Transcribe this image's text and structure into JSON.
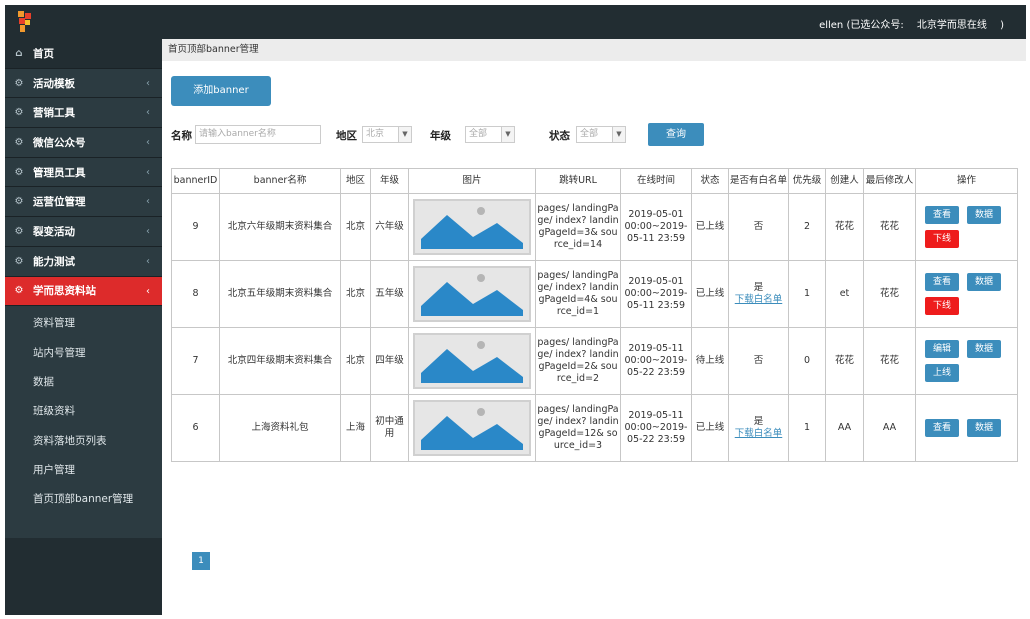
{
  "topbar": {
    "user_text": "ellen  (已选公众号:",
    "account": "北京学而思在线",
    "close_paren": ")"
  },
  "sidebar": {
    "home": "首页",
    "items": [
      {
        "label": "活动模板"
      },
      {
        "label": "营销工具"
      },
      {
        "label": "微信公众号"
      },
      {
        "label": "管理员工具"
      },
      {
        "label": "运营位管理"
      },
      {
        "label": "裂变活动"
      },
      {
        "label": "能力测试"
      },
      {
        "label": "学而思资料站"
      }
    ],
    "submenu": [
      "资料管理",
      "站内号管理",
      "数据",
      "班级资料",
      "资料落地页列表",
      "用户管理",
      "首页顶部banner管理"
    ]
  },
  "breadcrumb": "首页顶部banner管理",
  "add_button": "添加banner",
  "filters": {
    "name_label": "名称",
    "name_placeholder": "请输入banner名称",
    "region_label": "地区",
    "region_value": "北京",
    "grade_label": "年级",
    "grade_value": "全部",
    "status_label": "状态",
    "status_value": "全部",
    "query_button": "查询"
  },
  "table": {
    "headers": [
      "bannerID",
      "banner名称",
      "地区",
      "年级",
      "图片",
      "跳转URL",
      "在线时间",
      "状态",
      "是否有白名单",
      "优先级",
      "创建人",
      "最后修改人",
      "操作"
    ],
    "rows": [
      {
        "id": "9",
        "name": "北京六年级期末资料集合",
        "region": "北京",
        "grade": "六年级",
        "url": "pages/ landingPage/ index? landingPageId=3& source_id=14",
        "time": "2019-05-01 00:00~2019-05-11 23:59",
        "status": "已上线",
        "whitelist": "否",
        "whitelist_link": "",
        "priority": "2",
        "creator": "花花",
        "modifier": "花花",
        "actions": [
          {
            "label": "查看",
            "color": "blue"
          },
          {
            "label": "数据",
            "color": "blue"
          },
          {
            "label": "下线",
            "color": "red"
          }
        ]
      },
      {
        "id": "8",
        "name": "北京五年级期末资料集合",
        "region": "北京",
        "grade": "五年级",
        "url": "pages/ landingPage/ index? landingPageId=4& source_id=1",
        "time": "2019-05-01 00:00~2019-05-11 23:59",
        "status": "已上线",
        "whitelist": "是",
        "whitelist_link": "下载白名单",
        "priority": "1",
        "creator": "et",
        "modifier": "花花",
        "actions": [
          {
            "label": "查看",
            "color": "blue"
          },
          {
            "label": "数据",
            "color": "blue"
          },
          {
            "label": "下线",
            "color": "red"
          }
        ]
      },
      {
        "id": "7",
        "name": "北京四年级期末资料集合",
        "region": "北京",
        "grade": "四年级",
        "url": "pages/ landingPage/ index? landingPageId=2& source_id=2",
        "time": "2019-05-11 00:00~2019-05-22 23:59",
        "status": "待上线",
        "whitelist": "否",
        "whitelist_link": "",
        "priority": "0",
        "creator": "花花",
        "modifier": "花花",
        "actions": [
          {
            "label": "编辑",
            "color": "blue"
          },
          {
            "label": "数据",
            "color": "blue"
          },
          {
            "label": "上线",
            "color": "blue"
          }
        ]
      },
      {
        "id": "6",
        "name": "上海资料礼包",
        "region": "上海",
        "grade": "初中通用",
        "url": "pages/ landingPage/ index? landingPageId=12& source_id=3",
        "time": "2019-05-11 00:00~2019-05-22 23:59",
        "status": "已上线",
        "whitelist": "是",
        "whitelist_link": "下载白名单",
        "priority": "1",
        "creator": "AA",
        "modifier": "AA",
        "actions": [
          {
            "label": "查看",
            "color": "blue"
          },
          {
            "label": "数据",
            "color": "blue"
          }
        ]
      }
    ]
  },
  "pagination": {
    "current": "1"
  },
  "colors": {
    "sidebar_bg": "#222d32",
    "active_red": "#dd2b2b",
    "primary_blue": "#3c8dbc",
    "danger_red": "#ee1c1c"
  }
}
